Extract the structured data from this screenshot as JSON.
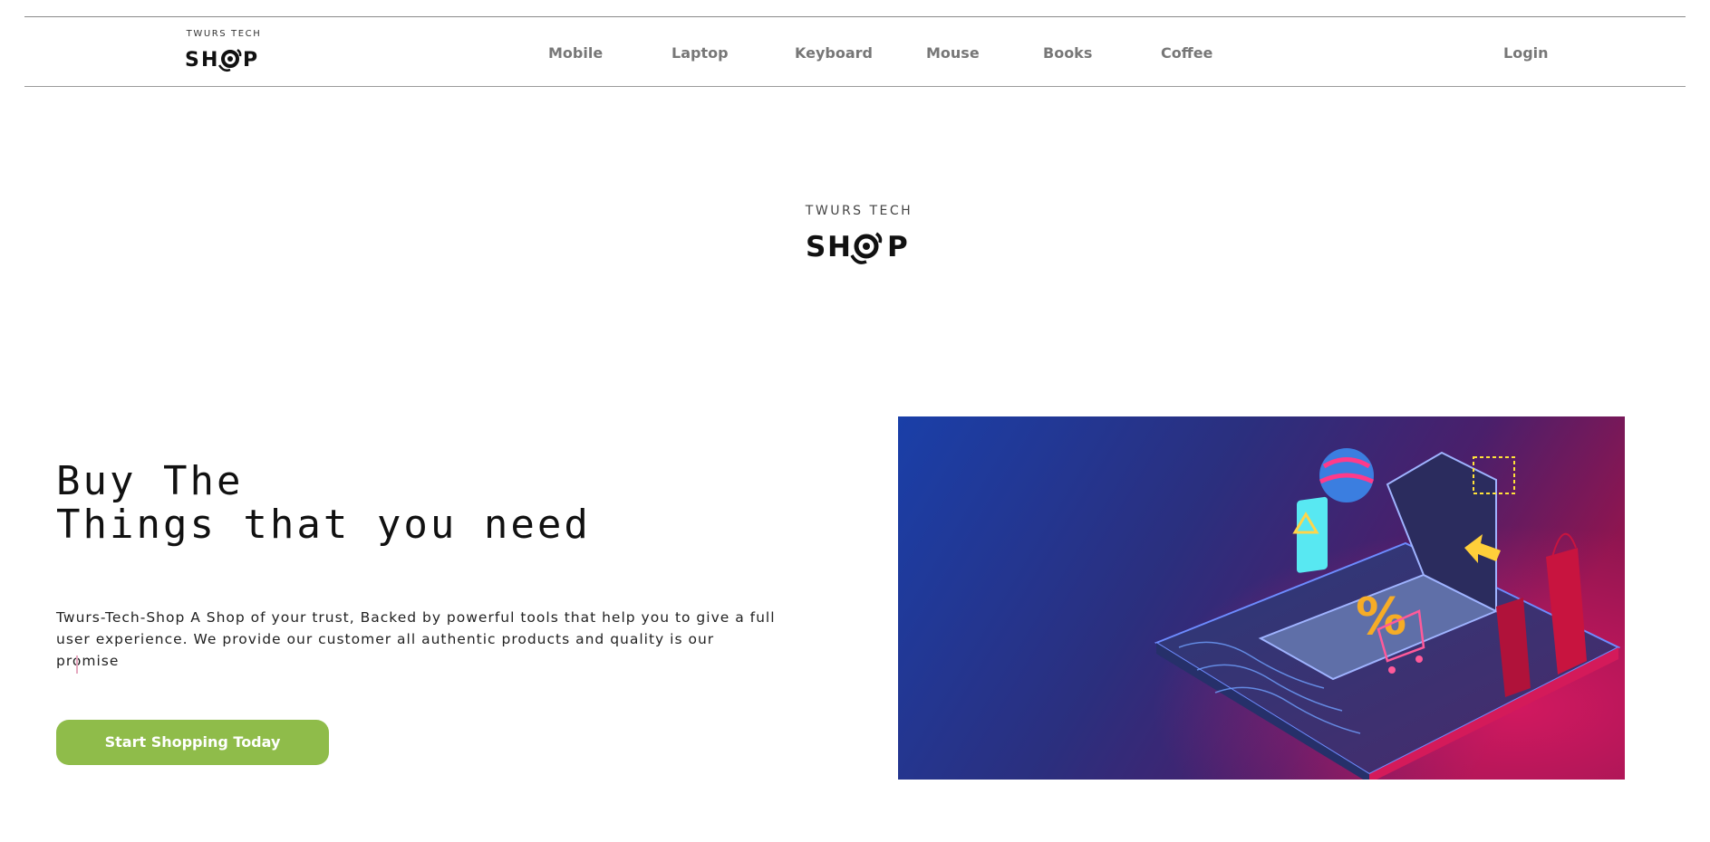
{
  "brand": {
    "top": "TWURS TECH",
    "bottom": "SH P"
  },
  "nav": {
    "links": [
      "Mobile",
      "Laptop",
      "Keyboard",
      "Mouse",
      "Books",
      "Coffee"
    ],
    "login": "Login"
  },
  "hero": {
    "headline_line1": "Buy The",
    "headline_line2": "Things that you need",
    "description_line1": "Twurs-Tech-Shop A Shop of your trust, Backed by powerful tools that help you to give a full",
    "description_line2": "user experience. We provide our customer all authentic products and quality is our promise",
    "cta": "Start Shopping Today"
  },
  "colors": {
    "accent": "#8fbc4a",
    "nav_text": "#777777",
    "caret": "#e5a8bf"
  },
  "icons": [
    "shop-logo",
    "shopping-hero-illustration"
  ]
}
